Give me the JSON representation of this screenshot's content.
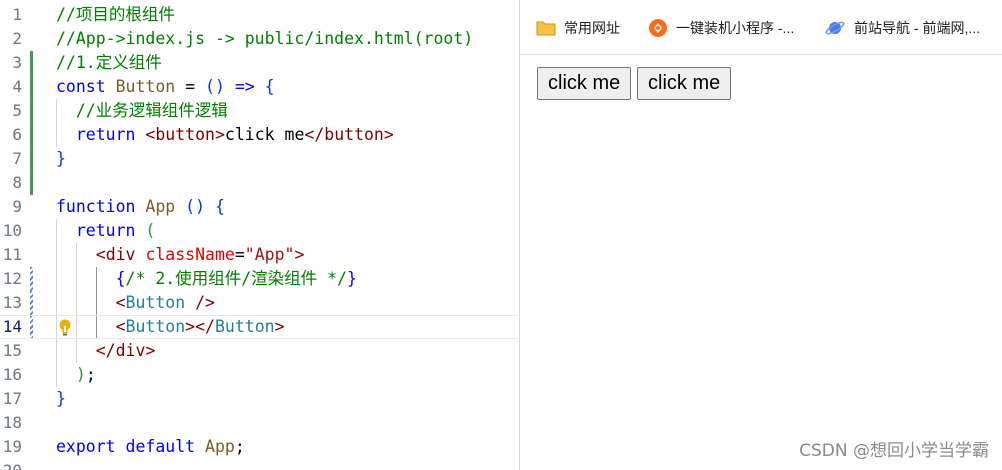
{
  "editor": {
    "lines": [
      {
        "n": "1",
        "tokens": [
          [
            "t-comment",
            "//项目的根组件"
          ]
        ]
      },
      {
        "n": "2",
        "tokens": [
          [
            "t-comment",
            "//App->index.js -> public/index.html(root)"
          ]
        ]
      },
      {
        "n": "3",
        "tokens": [
          [
            "t-comment",
            "//1.定义组件"
          ]
        ]
      },
      {
        "n": "4",
        "tokens": [
          [
            "t-kw",
            "const"
          ],
          [
            "t-text",
            " "
          ],
          [
            "t-name",
            "Button"
          ],
          [
            "t-op",
            " = "
          ],
          [
            "t-paren",
            "()"
          ],
          [
            "t-op",
            " "
          ],
          [
            "t-kw",
            "=>"
          ],
          [
            "t-op",
            " "
          ],
          [
            "t-paren",
            "{"
          ]
        ]
      },
      {
        "n": "5",
        "tokens": [
          [
            "t-text",
            "  "
          ],
          [
            "t-comment",
            "//业务逻辑组件逻辑"
          ]
        ]
      },
      {
        "n": "6",
        "tokens": [
          [
            "t-text",
            "  "
          ],
          [
            "t-kw",
            "return"
          ],
          [
            "t-text",
            " "
          ],
          [
            "t-punct",
            "<"
          ],
          [
            "t-tag",
            "button"
          ],
          [
            "t-punct",
            ">"
          ],
          [
            "t-text",
            "click me"
          ],
          [
            "t-punct",
            "</"
          ],
          [
            "t-tag",
            "button"
          ],
          [
            "t-punct",
            ">"
          ]
        ]
      },
      {
        "n": "7",
        "tokens": [
          [
            "t-paren",
            "}"
          ]
        ]
      },
      {
        "n": "8",
        "tokens": []
      },
      {
        "n": "9",
        "tokens": [
          [
            "t-kw",
            "function"
          ],
          [
            "t-text",
            " "
          ],
          [
            "t-name",
            "App"
          ],
          [
            "t-text",
            " "
          ],
          [
            "t-paren",
            "()"
          ],
          [
            "t-text",
            " "
          ],
          [
            "t-paren",
            "{"
          ]
        ]
      },
      {
        "n": "10",
        "tokens": [
          [
            "t-text",
            "  "
          ],
          [
            "t-kw",
            "return"
          ],
          [
            "t-text",
            " "
          ],
          [
            "t-brace",
            "("
          ]
        ]
      },
      {
        "n": "11",
        "tokens": [
          [
            "t-text",
            "    "
          ],
          [
            "t-punct",
            "<"
          ],
          [
            "t-tag",
            "div"
          ],
          [
            "t-text",
            " "
          ],
          [
            "t-attr",
            "className"
          ],
          [
            "t-op",
            "="
          ],
          [
            "t-str",
            "\"App\""
          ],
          [
            "t-punct",
            ">"
          ]
        ]
      },
      {
        "n": "12",
        "tokens": [
          [
            "t-text",
            "      "
          ],
          [
            "t-kw",
            "{"
          ],
          [
            "t-comment",
            "/* 2.使用组件/渲染组件 */"
          ],
          [
            "t-kw",
            "}"
          ]
        ]
      },
      {
        "n": "13",
        "tokens": [
          [
            "t-text",
            "      "
          ],
          [
            "t-punct",
            "<"
          ],
          [
            "t-tagc",
            "Button"
          ],
          [
            "t-text",
            " "
          ],
          [
            "t-punct",
            "/>"
          ]
        ]
      },
      {
        "n": "14",
        "tokens": [
          [
            "t-text",
            "      "
          ],
          [
            "t-punct",
            "<"
          ],
          [
            "t-tagc",
            "Button"
          ],
          [
            "t-punct",
            "></"
          ],
          [
            "t-tagc",
            "Button"
          ],
          [
            "t-punct",
            ">"
          ]
        ]
      },
      {
        "n": "15",
        "tokens": [
          [
            "t-text",
            "    "
          ],
          [
            "t-punct",
            "</"
          ],
          [
            "t-tag",
            "div"
          ],
          [
            "t-punct",
            ">"
          ]
        ]
      },
      {
        "n": "16",
        "tokens": [
          [
            "t-text",
            "  "
          ],
          [
            "t-brace",
            ")"
          ],
          [
            "t-op",
            ";"
          ]
        ]
      },
      {
        "n": "17",
        "tokens": [
          [
            "t-paren",
            "}"
          ]
        ]
      },
      {
        "n": "18",
        "tokens": []
      },
      {
        "n": "19",
        "tokens": [
          [
            "t-kw",
            "export"
          ],
          [
            "t-text",
            " "
          ],
          [
            "t-kw",
            "default"
          ],
          [
            "t-text",
            " "
          ],
          [
            "t-name",
            "App"
          ],
          [
            "t-op",
            ";"
          ]
        ]
      },
      {
        "n": "20",
        "tokens": []
      }
    ],
    "added_lines": [
      "3",
      "4",
      "5",
      "6",
      "7",
      "8"
    ],
    "modified_lines": [
      "12",
      "13",
      "14"
    ],
    "current_line": "14",
    "lightbulb_line": "14",
    "lightbulb_icon": "lightbulb-icon"
  },
  "browser": {
    "bookmarks": [
      {
        "label": "常用网址",
        "icon": "folder-icon"
      },
      {
        "label": "一键装机小程序 -...",
        "icon": "app-icon"
      },
      {
        "label": "前站导航 - 前端网,...",
        "icon": "planet-icon"
      }
    ],
    "page": {
      "buttons": [
        "click me",
        "click me"
      ]
    }
  },
  "watermark": "CSDN @想回小学当学霸",
  "colors": {
    "comment": "#008000",
    "keyword": "#0000ff",
    "added_gutter": "#48985d",
    "modified_gutter": "#5a86c5",
    "button_bg": "#efefef"
  }
}
